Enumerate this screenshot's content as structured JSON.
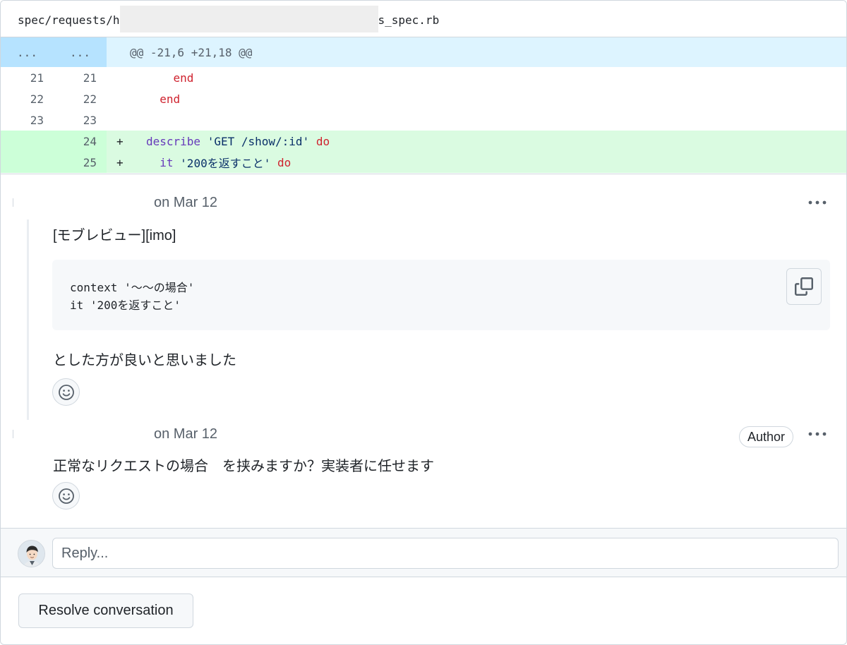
{
  "file": {
    "path_prefix": "spec/requests/h",
    "path_suffix": "s_spec.rb"
  },
  "diff": {
    "hunk": {
      "left": "...",
      "right": "...",
      "header": "@@ -21,6 +21,18 @@"
    },
    "lines": [
      {
        "old": "21",
        "new": "21",
        "type": "context",
        "tokens": [
          {
            "t": "    ",
            "c": ""
          },
          {
            "t": "end",
            "c": "kw"
          }
        ]
      },
      {
        "old": "22",
        "new": "22",
        "type": "context",
        "tokens": [
          {
            "t": "  ",
            "c": ""
          },
          {
            "t": "end",
            "c": "kw"
          }
        ]
      },
      {
        "old": "23",
        "new": "23",
        "type": "context",
        "tokens": []
      },
      {
        "old": "",
        "new": "24",
        "type": "add",
        "marker": "+",
        "tokens": [
          {
            "t": "describe",
            "c": "fn"
          },
          {
            "t": " ",
            "c": ""
          },
          {
            "t": "'GET /show/:id'",
            "c": "str"
          },
          {
            "t": " ",
            "c": ""
          },
          {
            "t": "do",
            "c": "kw"
          }
        ]
      },
      {
        "old": "",
        "new": "25",
        "type": "add",
        "marker": "+",
        "tokens": [
          {
            "t": "  ",
            "c": ""
          },
          {
            "t": "it",
            "c": "fn"
          },
          {
            "t": " ",
            "c": ""
          },
          {
            "t": "'200を返すこと'",
            "c": "str"
          },
          {
            "t": " ",
            "c": ""
          },
          {
            "t": "do",
            "c": "kw"
          }
        ]
      }
    ]
  },
  "comments": [
    {
      "date": "on Mar 12",
      "menu": "•••",
      "text_top": "[モブレビュー][imo]",
      "code_lines": [
        "context '〜〜の場合'",
        "it '200を返すこと'"
      ],
      "text_bottom": "とした方が良いと思いました"
    },
    {
      "date": "on Mar 12",
      "badge": "Author",
      "menu": "•••",
      "text": "正常なリクエストの場合　を挟みますか？実装者に任せます"
    }
  ],
  "reply": {
    "placeholder": "Reply..."
  },
  "resolve": {
    "label": "Resolve conversation"
  },
  "icons": {
    "copy": "copy-icon",
    "emoji": "smiley-icon",
    "kebab": "kebab-horizontal-icon"
  },
  "colors": {
    "hunk_bg": "#ddf4ff",
    "add_bg": "#dafbe1",
    "keyword": "#cf222e",
    "function": "#6639ba",
    "string": "#0a3069"
  }
}
